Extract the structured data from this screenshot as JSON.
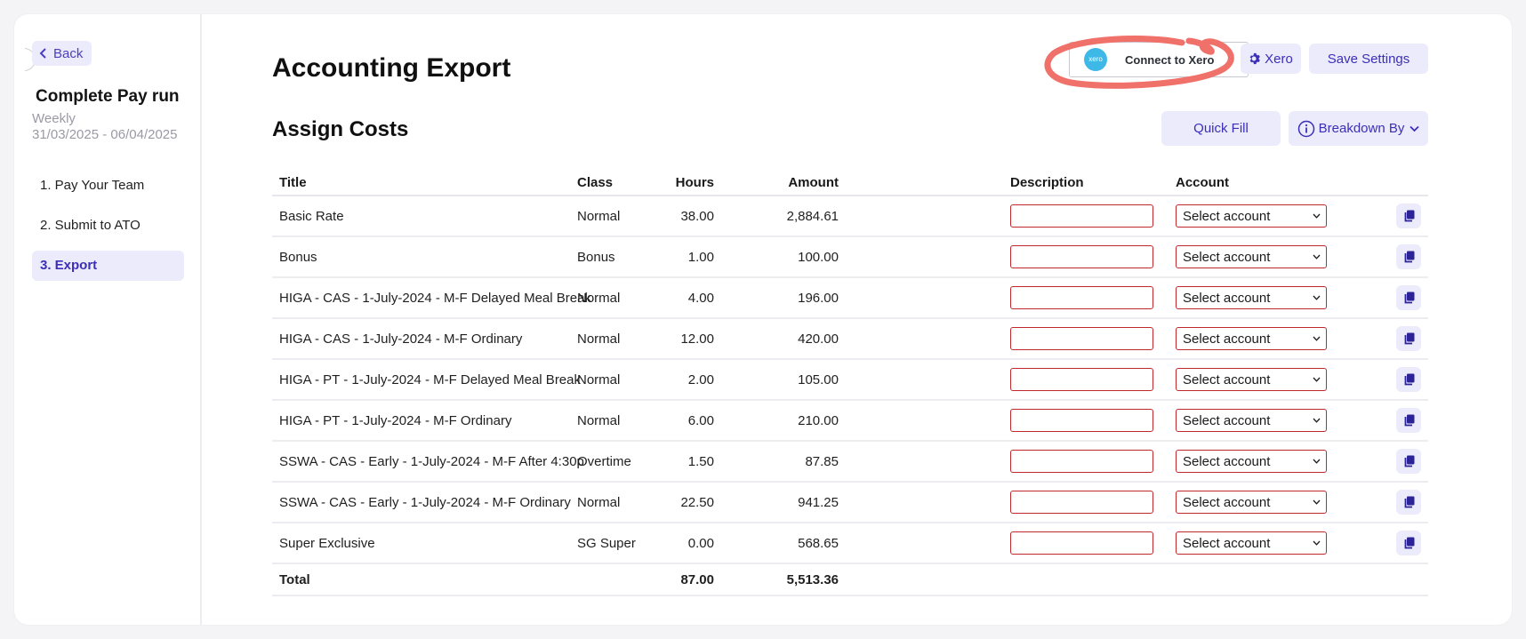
{
  "sidebar": {
    "back_label": "Back",
    "title": "Complete Pay run",
    "frequency": "Weekly",
    "dates": "31/03/2025 - 06/04/2025",
    "steps": [
      {
        "label": "1. Pay Your Team",
        "active": false
      },
      {
        "label": "2. Submit to ATO",
        "active": false
      },
      {
        "label": "3. Export",
        "active": true
      }
    ]
  },
  "header": {
    "title": "Accounting Export",
    "connect_xero_label": "Connect to Xero",
    "xero_logo_text": "xero",
    "xero_settings_label": "Xero",
    "save_settings_label": "Save Settings"
  },
  "assign": {
    "title": "Assign Costs",
    "quick_fill_label": "Quick Fill",
    "breakdown_label": "Breakdown By"
  },
  "table": {
    "headers": {
      "title": "Title",
      "class": "Class",
      "hours": "Hours",
      "amount": "Amount",
      "description": "Description",
      "account": "Account"
    },
    "select_placeholder": "Select account",
    "rows": [
      {
        "title": "Basic Rate",
        "class": "Normal",
        "hours": "38.00",
        "amount": "2,884.61"
      },
      {
        "title": "Bonus",
        "class": "Bonus",
        "hours": "1.00",
        "amount": "100.00"
      },
      {
        "title": "HIGA - CAS - 1-July-2024 - M-F Delayed Meal Break",
        "class": "Normal",
        "hours": "4.00",
        "amount": "196.00"
      },
      {
        "title": "HIGA - CAS - 1-July-2024 - M-F Ordinary",
        "class": "Normal",
        "hours": "12.00",
        "amount": "420.00"
      },
      {
        "title": "HIGA - PT - 1-July-2024 - M-F Delayed Meal Break",
        "class": "Normal",
        "hours": "2.00",
        "amount": "105.00"
      },
      {
        "title": "HIGA - PT - 1-July-2024 - M-F Ordinary",
        "class": "Normal",
        "hours": "6.00",
        "amount": "210.00"
      },
      {
        "title": "SSWA - CAS - Early - 1-July-2024 - M-F After 4:30p",
        "class": "Overtime",
        "hours": "1.50",
        "amount": "87.85"
      },
      {
        "title": "SSWA - CAS - Early - 1-July-2024 - M-F Ordinary",
        "class": "Normal",
        "hours": "22.50",
        "amount": "941.25"
      },
      {
        "title": "Super Exclusive",
        "class": "SG Super",
        "hours": "0.00",
        "amount": "568.65"
      }
    ],
    "total": {
      "label": "Total",
      "hours": "87.00",
      "amount": "5,513.36"
    }
  },
  "colors": {
    "accent": "#3b2fb8",
    "button_bg": "#ecebfb",
    "annotation": "#f0706a",
    "error_border": "#c0282e",
    "xero_blue": "#3eb8e6"
  }
}
